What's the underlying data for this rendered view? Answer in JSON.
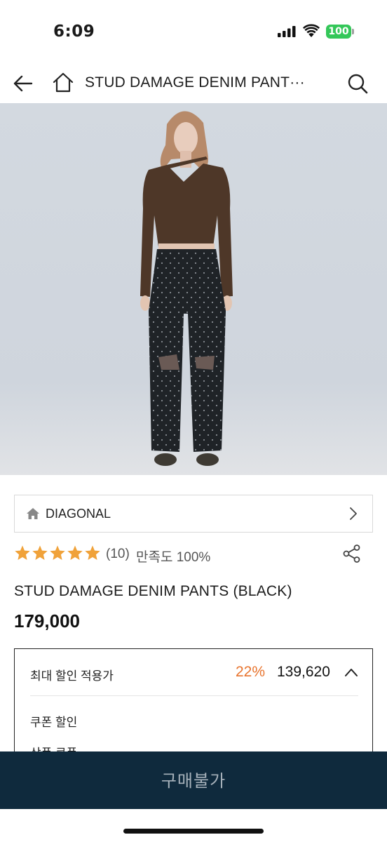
{
  "status_bar": {
    "time": "6:09",
    "battery": "100",
    "battery_color": "#34c759"
  },
  "header": {
    "title": "STUD DAMAGE DENIM PANT···",
    "icons": [
      "back-arrow-icon",
      "home-icon",
      "search-icon"
    ]
  },
  "product": {
    "brand": "DIAGONAL",
    "rating": {
      "stars": 5,
      "max_stars": 5,
      "count": "(10)",
      "satisfaction": "만족도 100%",
      "star_color": "#f0a23a"
    },
    "title": "STUD DAMAGE DENIM PANTS (BLACK)",
    "price": "179,000"
  },
  "discount": {
    "label": "최대 할인 적용가",
    "rate": "22%",
    "rate_color": "#e8742e",
    "discounted_price": "139,620",
    "coupon_label": "쿠폰 할인",
    "product_coupon_label": "상품 쿠폰"
  },
  "buy_bar": {
    "label": "구매불가",
    "background": "#0f2a3d"
  }
}
